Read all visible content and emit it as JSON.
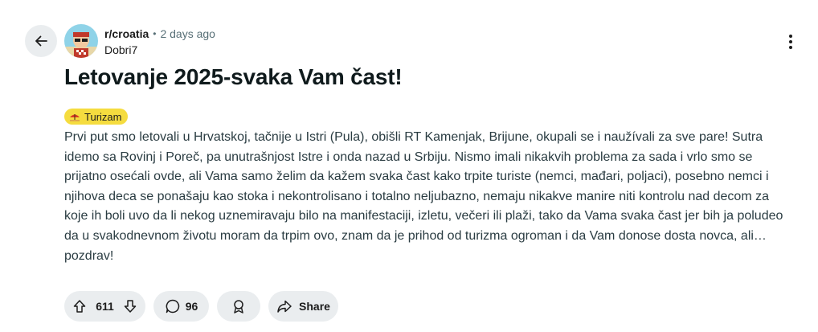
{
  "post": {
    "subreddit": "r/croatia",
    "separator": "•",
    "time_ago": "2 days ago",
    "author": "Dobri7",
    "title": "Letovanje 2025-svaka Vam čast!",
    "flair": {
      "label": "Turizam",
      "color": "#f5dc3f",
      "icon": "palm-umbrella-icon"
    },
    "body": "Prvi put smo letovali u Hrvatskoj, tačnije u Istri (Pula), obišli RT Kamenjak, Brijune, okupali se i naužívali za sve pare! Sutra idemo sa Rovinj i Poreč, pa unutrašnjost Istre i onda nazad u Srbiju. Nismo imali nikakvih problema za sada i vrlo smo se prijatno osećali ovde, ali Vama samo želim da kažem svaka čast kako trpite turiste (nemci, mađari, poljaci), posebno nemci i njihova deca se ponašaju kao stoka i nekontrolisano i totalno neljubazno, nemaju nikakve manire niti kontrolu nad decom za koje ih boli uvo da li nekog uznemiravaju bilo na manifestaciji, izletu, večeri ili plaži, tako da Vama svaka čast jer bih ja poludeo da u svakodnevnom životu moram da trpim ovo, znam da je prihod od turizma ogroman i da Vam donose dosta novca, ali… pozdrav!"
  },
  "actions": {
    "votes": "611",
    "comments": "96",
    "share_label": "Share"
  },
  "icons": {
    "back": "arrow-left-icon",
    "more": "ellipsis-vertical-icon",
    "upvote": "arrow-up-icon",
    "downvote": "arrow-down-icon",
    "comment": "speech-bubble-icon",
    "award": "award-icon",
    "share": "share-arrow-icon"
  }
}
